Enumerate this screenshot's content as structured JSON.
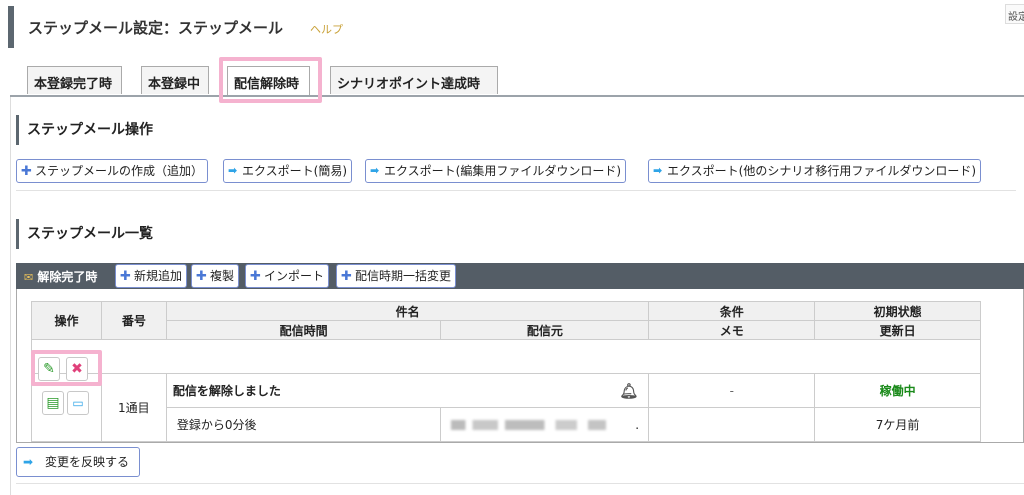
{
  "header": {
    "title": "ステップメール設定：ステップメール",
    "help": "ヘルプ",
    "settings_chip": "設定"
  },
  "tabs": [
    {
      "label": "本登録完了時",
      "active": false
    },
    {
      "label": "本登録中",
      "active": false
    },
    {
      "label": "配信解除時",
      "active": true
    },
    {
      "label": "シナリオポイント達成時",
      "active": false
    }
  ],
  "operations": {
    "title": "ステップメール操作",
    "buttons": [
      {
        "label": "ステップメールの作成（追加）",
        "icon": "plus-icon"
      },
      {
        "label": "エクスポート(簡易)",
        "icon": "arrow-icon"
      },
      {
        "label": "エクスポート(編集用ファイルダウンロード)",
        "icon": "arrow-icon"
      },
      {
        "label": "エクスポート(他のシナリオ移行用ファイルダウンロード)",
        "icon": "arrow-icon"
      }
    ]
  },
  "list": {
    "title": "ステップメール一覧",
    "group": {
      "label": "解除完了時",
      "buttons": [
        "新規追加",
        "複製",
        "インポート",
        "配信時期一括変更"
      ]
    },
    "headers": {
      "operation": "操作",
      "number": "番号",
      "subject": "件名",
      "condition": "条件",
      "initial_state": "初期状態",
      "send_timing": "配信時間",
      "sender": "配信元",
      "memo": "メモ",
      "updated": "更新日"
    },
    "rows": [
      {
        "number": "1通目",
        "subject": "配信を解除しました",
        "condition": "-",
        "state": "稼働中",
        "timing": "登録から0分後",
        "sender": ".",
        "memo": "",
        "updated": "7ケ月前"
      }
    ]
  },
  "reflect_button": "変更を反映する",
  "colors": {
    "accent": "#4a78d6",
    "highlight": "#f5b2cf",
    "state_green": "#1a8a1a",
    "group_bar": "#545d66"
  }
}
